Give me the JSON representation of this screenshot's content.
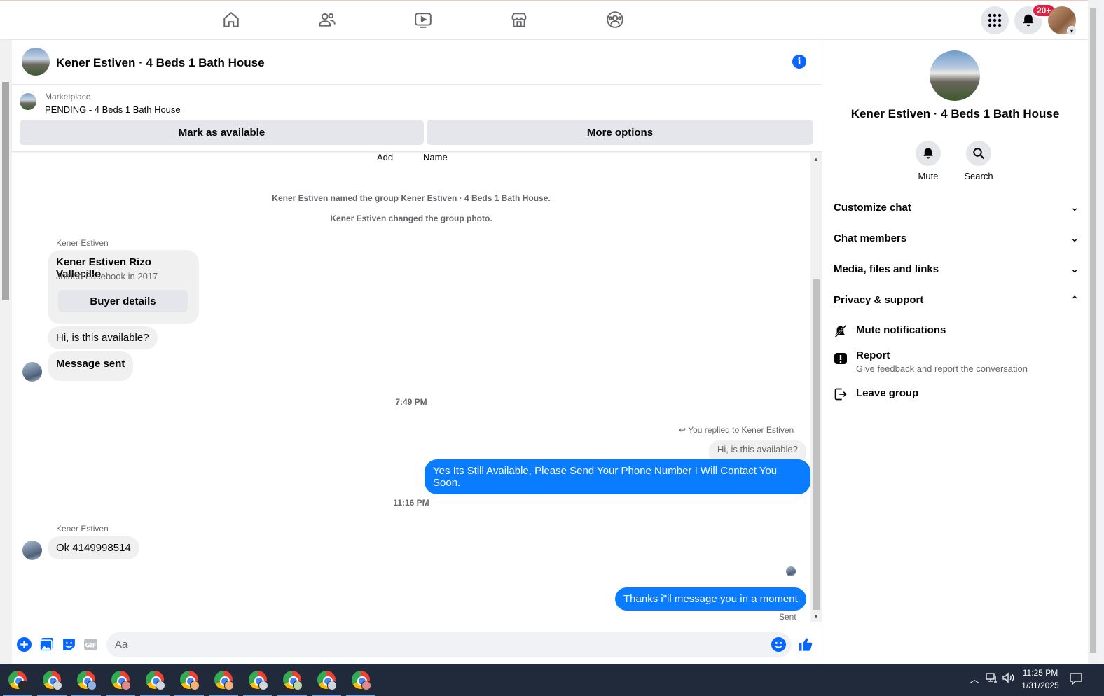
{
  "topnav": {
    "icons": [
      "home-icon",
      "friends-icon",
      "watch-icon",
      "marketplace-icon",
      "groups-icon"
    ],
    "notifications_badge": "20+"
  },
  "chat": {
    "title": "Kener Estiven · 4 Beds 1 Bath House",
    "marketplace": {
      "label": "Marketplace",
      "status": "PENDING - 4 Beds 1 Bath House",
      "mark_available": "Mark as available",
      "more_options": "More options"
    },
    "top_cut": {
      "add": "Add",
      "name": "Name"
    },
    "system_messages": [
      "Kener Estiven named the group Kener Estiven · 4 Beds 1 Bath House.",
      "Kener Estiven changed the group photo."
    ],
    "buyer_card": {
      "sender": "Kener Estiven",
      "name": "Kener Estiven Rizo Vallecillo",
      "joined": "Joined Facebook in 2017",
      "button": "Buyer details"
    },
    "msg_available": "Hi, is this available?",
    "msg_sent": "Message sent",
    "time1": "7:49 PM",
    "reply_info": "You replied to Kener Estiven",
    "reply_quote": "Hi, is this available?",
    "out_msg1": "Yes Its Still Available, Please Send Your Phone Number I Will Contact You Soon.",
    "time2": "11:16 PM",
    "sender2": "Kener Estiven",
    "in_msg2": "Ok 4149998514",
    "out_msg2": "Thanks i\"il message you in a moment",
    "sent_status": "Sent",
    "composer_placeholder": "Aa"
  },
  "right_panel": {
    "title": "Kener Estiven · 4 Beds 1 Bath House",
    "mute": "Mute",
    "search": "Search",
    "sections": {
      "customize": "Customize chat",
      "members": "Chat members",
      "media": "Media, files and links",
      "privacy": "Privacy & support"
    },
    "items": {
      "mute_notifications": "Mute notifications",
      "report": "Report",
      "report_sub": "Give feedback and report the conversation",
      "leave_group": "Leave group"
    }
  },
  "taskbar": {
    "time": "11:25 PM",
    "date": "1/31/2025"
  },
  "colors": {
    "accent": "#0866ff",
    "outgoing_bubble": "#0a7cff",
    "badge": "#e41e3f"
  }
}
